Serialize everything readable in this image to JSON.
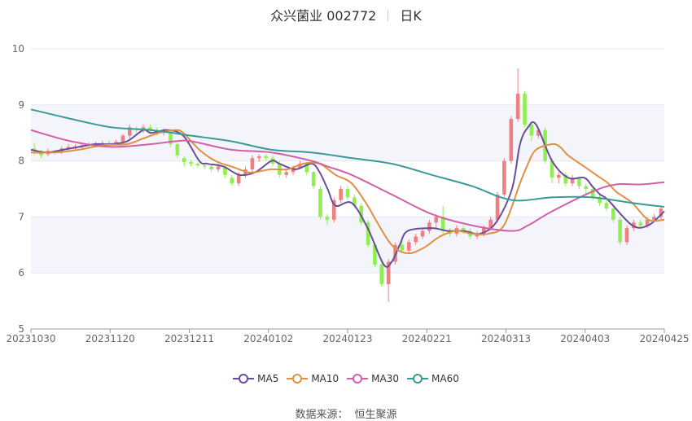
{
  "header": {
    "name": "众兴菌业 002772",
    "period": "日K"
  },
  "chart_data": {
    "type": "line",
    "subtype": "candlestick-with-moving-averages",
    "ylim": [
      5,
      10
    ],
    "yticks": [
      "5",
      "6",
      "7",
      "8",
      "9",
      "10"
    ],
    "xticks": [
      "20231030",
      "20231120",
      "20231211",
      "20240102",
      "20240123",
      "20240221",
      "20240313",
      "20240403",
      "20240425"
    ],
    "grid": "horizontal",
    "legend_position": "bottom",
    "colors": {
      "up": "#f08080",
      "down": "#90ee50",
      "MA5": "#6a4c9c",
      "MA10": "#e09040",
      "MA30": "#d060a8",
      "MA60": "#3a9a9a"
    },
    "series": [
      {
        "name": "MA5",
        "x": [
          0,
          2,
          4,
          6,
          8,
          10,
          12,
          14,
          15,
          17,
          19,
          21,
          22,
          24,
          26,
          28,
          30,
          31,
          33,
          35,
          36,
          37,
          38,
          40,
          42,
          44,
          45,
          46,
          47,
          50,
          52,
          54,
          56,
          58,
          60,
          61,
          62,
          63,
          65,
          67,
          69,
          70,
          71,
          72,
          75,
          77,
          79
        ],
        "values": [
          8.2,
          8.15,
          8.2,
          8.25,
          8.3,
          8.3,
          8.35,
          8.55,
          8.5,
          8.55,
          8.45,
          8.0,
          7.95,
          7.9,
          7.75,
          7.8,
          8.0,
          7.95,
          7.85,
          7.95,
          7.8,
          7.5,
          7.2,
          7.25,
          6.8,
          6.15,
          6.2,
          6.5,
          6.75,
          6.8,
          6.75,
          6.75,
          6.7,
          6.9,
          7.5,
          8.3,
          8.6,
          8.65,
          8.0,
          7.7,
          7.7,
          7.55,
          7.4,
          7.3,
          6.85,
          6.85,
          7.1
        ]
      },
      {
        "name": "MA10",
        "x": [
          0,
          3,
          6,
          9,
          12,
          14,
          16,
          18,
          19,
          21,
          23,
          25,
          27,
          28,
          30,
          32,
          34,
          36,
          38,
          40,
          42,
          43,
          45,
          47,
          49,
          51,
          53,
          55,
          57,
          59,
          61,
          62,
          63,
          65,
          66,
          67,
          69,
          71,
          72,
          73,
          75,
          77,
          79
        ],
        "values": [
          8.15,
          8.15,
          8.2,
          8.28,
          8.3,
          8.4,
          8.5,
          8.55,
          8.5,
          8.2,
          8.0,
          7.9,
          7.8,
          7.8,
          7.85,
          7.85,
          7.95,
          7.95,
          7.75,
          7.6,
          7.2,
          6.95,
          6.5,
          6.35,
          6.45,
          6.65,
          6.75,
          6.7,
          6.7,
          6.85,
          7.6,
          7.95,
          8.2,
          8.3,
          8.25,
          8.1,
          7.9,
          7.7,
          7.6,
          7.45,
          7.25,
          6.95,
          6.95
        ]
      },
      {
        "name": "MA30",
        "x": [
          0,
          5,
          10,
          15,
          18,
          20,
          25,
          30,
          35,
          37,
          40,
          45,
          50,
          55,
          60,
          62,
          65,
          70,
          73,
          76,
          79
        ],
        "values": [
          8.55,
          8.35,
          8.25,
          8.3,
          8.35,
          8.35,
          8.2,
          8.15,
          8.0,
          7.9,
          7.75,
          7.4,
          7.05,
          6.85,
          6.75,
          6.85,
          7.1,
          7.45,
          7.58,
          7.58,
          7.62
        ]
      },
      {
        "name": "MA60",
        "x": [
          0,
          5,
          10,
          15,
          20,
          25,
          30,
          35,
          40,
          45,
          50,
          55,
          60,
          65,
          70,
          75,
          79
        ],
        "values": [
          8.92,
          8.75,
          8.6,
          8.55,
          8.45,
          8.35,
          8.2,
          8.15,
          8.05,
          7.95,
          7.75,
          7.55,
          7.3,
          7.35,
          7.35,
          7.25,
          7.18
        ]
      }
    ],
    "candles": [
      [
        0,
        8.22,
        8.18,
        8.32,
        8.1
      ],
      [
        1,
        8.15,
        8.1,
        8.2,
        8.05
      ],
      [
        2,
        8.12,
        8.18,
        8.22,
        8.08
      ],
      [
        3,
        8.18,
        8.15,
        8.2,
        8.1
      ],
      [
        4,
        8.15,
        8.22,
        8.26,
        8.12
      ],
      [
        5,
        8.22,
        8.25,
        8.3,
        8.18
      ],
      [
        6,
        8.22,
        8.26,
        8.3,
        8.2
      ],
      [
        7,
        8.25,
        8.28,
        8.32,
        8.22
      ],
      [
        8,
        8.3,
        8.27,
        8.34,
        8.24
      ],
      [
        9,
        8.27,
        8.3,
        8.34,
        8.25
      ],
      [
        10,
        8.3,
        8.32,
        8.36,
        8.25
      ],
      [
        11,
        8.32,
        8.3,
        8.36,
        8.27
      ],
      [
        12,
        8.3,
        8.34,
        8.38,
        8.28
      ],
      [
        13,
        8.34,
        8.45,
        8.48,
        8.3
      ],
      [
        14,
        8.45,
        8.6,
        8.65,
        8.4
      ],
      [
        15,
        8.58,
        8.55,
        8.62,
        8.5
      ],
      [
        16,
        8.55,
        8.6,
        8.65,
        8.5
      ],
      [
        17,
        8.6,
        8.55,
        8.65,
        8.48
      ],
      [
        18,
        8.55,
        8.5,
        8.6,
        8.45
      ],
      [
        19,
        8.5,
        8.52,
        8.58,
        8.45
      ],
      [
        20,
        8.52,
        8.3,
        8.55,
        8.25
      ],
      [
        21,
        8.3,
        8.1,
        8.32,
        8.05
      ],
      [
        22,
        8.05,
        7.98,
        8.08,
        7.9
      ],
      [
        23,
        7.98,
        7.95,
        8.02,
        7.9
      ],
      [
        24,
        7.95,
        7.92,
        7.98,
        7.88
      ],
      [
        25,
        7.92,
        7.9,
        7.96,
        7.85
      ],
      [
        26,
        7.9,
        7.85,
        7.95,
        7.8
      ],
      [
        27,
        7.85,
        7.9,
        7.95,
        7.8
      ],
      [
        28,
        7.9,
        7.75,
        7.92,
        7.7
      ],
      [
        29,
        7.7,
        7.6,
        7.75,
        7.55
      ],
      [
        30,
        7.6,
        7.75,
        7.8,
        7.55
      ],
      [
        31,
        7.75,
        7.85,
        7.9,
        7.7
      ],
      [
        32,
        7.85,
        8.05,
        8.1,
        7.8
      ],
      [
        33,
        8.05,
        8.08,
        8.12,
        7.98
      ],
      [
        34,
        8.08,
        8.05,
        8.12,
        8.0
      ],
      [
        35,
        8.05,
        7.95,
        8.1,
        7.9
      ],
      [
        36,
        7.95,
        7.75,
        8.0,
        7.7
      ],
      [
        37,
        7.75,
        7.8,
        7.85,
        7.7
      ],
      [
        38,
        7.8,
        7.88,
        7.92,
        7.75
      ],
      [
        39,
        7.88,
        7.95,
        8.0,
        7.85
      ],
      [
        40,
        7.95,
        7.8,
        7.98,
        7.75
      ],
      [
        41,
        7.8,
        7.55,
        7.82,
        7.5
      ],
      [
        42,
        7.5,
        7.0,
        7.55,
        6.95
      ],
      [
        43,
        7.0,
        6.95,
        7.05,
        6.85
      ],
      [
        44,
        6.95,
        7.3,
        7.35,
        6.9
      ],
      [
        45,
        7.3,
        7.5,
        7.55,
        7.25
      ],
      [
        46,
        7.5,
        7.35,
        7.55,
        7.3
      ],
      [
        47,
        7.35,
        7.2,
        7.4,
        7.15
      ],
      [
        48,
        7.2,
        6.9,
        7.25,
        6.85
      ],
      [
        49,
        6.9,
        6.5,
        6.95,
        6.45
      ],
      [
        50,
        6.5,
        6.15,
        6.55,
        6.1
      ],
      [
        51,
        6.15,
        5.8,
        6.2,
        5.75
      ],
      [
        52,
        5.8,
        6.2,
        6.25,
        5.48
      ],
      [
        53,
        6.2,
        6.5,
        6.55,
        6.15
      ],
      [
        54,
        6.5,
        6.4,
        6.6,
        6.35
      ],
      [
        55,
        6.4,
        6.55,
        6.6,
        6.35
      ],
      [
        56,
        6.55,
        6.65,
        6.7,
        6.5
      ],
      [
        57,
        6.65,
        6.75,
        6.8,
        6.6
      ],
      [
        58,
        6.75,
        6.9,
        6.95,
        6.7
      ],
      [
        59,
        6.9,
        7.0,
        7.05,
        6.8
      ],
      [
        60,
        7.0,
        6.75,
        7.2,
        6.7
      ],
      [
        61,
        6.75,
        6.7,
        6.8,
        6.65
      ],
      [
        62,
        6.7,
        6.8,
        6.85,
        6.65
      ],
      [
        63,
        6.8,
        6.75,
        6.85,
        6.7
      ],
      [
        64,
        6.75,
        6.65,
        6.8,
        6.6
      ],
      [
        65,
        6.65,
        6.7,
        6.75,
        6.6
      ],
      [
        66,
        6.7,
        6.8,
        6.85,
        6.65
      ],
      [
        67,
        6.8,
        6.95,
        7.0,
        6.75
      ],
      [
        68,
        6.95,
        7.4,
        7.45,
        6.9
      ],
      [
        69,
        7.4,
        8.0,
        8.05,
        7.35
      ],
      [
        70,
        8.0,
        8.75,
        8.8,
        7.95
      ],
      [
        71,
        8.75,
        9.2,
        9.65,
        8.7
      ],
      [
        72,
        9.2,
        8.65,
        9.25,
        8.6
      ],
      [
        73,
        8.65,
        8.45,
        8.7,
        8.35
      ],
      [
        74,
        8.45,
        8.55,
        8.6,
        8.4
      ],
      [
        75,
        8.55,
        8.0,
        8.6,
        7.95
      ],
      [
        76,
        8.0,
        7.7,
        8.05,
        7.6
      ],
      [
        77,
        7.7,
        7.75,
        7.8,
        7.6
      ],
      [
        78,
        7.75,
        7.6,
        7.8,
        7.55
      ],
      [
        79,
        7.6,
        7.7,
        7.75,
        7.55
      ],
      [
        80,
        7.7,
        7.55,
        7.72,
        7.5
      ],
      [
        81,
        7.55,
        7.5,
        7.6,
        7.4
      ],
      [
        82,
        7.5,
        7.35,
        7.55,
        7.3
      ],
      [
        83,
        7.35,
        7.25,
        7.4,
        7.2
      ],
      [
        84,
        7.25,
        7.15,
        7.3,
        7.1
      ],
      [
        85,
        7.15,
        6.95,
        7.2,
        6.9
      ],
      [
        86,
        6.95,
        6.55,
        7.0,
        6.5
      ],
      [
        87,
        6.55,
        6.8,
        6.85,
        6.5
      ],
      [
        88,
        6.8,
        6.9,
        6.95,
        6.75
      ],
      [
        89,
        6.9,
        6.85,
        6.95,
        6.8
      ],
      [
        90,
        6.85,
        6.95,
        7.0,
        6.8
      ],
      [
        91,
        6.95,
        7.0,
        7.05,
        6.9
      ],
      [
        92,
        7.0,
        7.15,
        7.2,
        6.95
      ]
    ]
  },
  "source": {
    "label": "数据来源：",
    "value": "恒生聚源"
  }
}
